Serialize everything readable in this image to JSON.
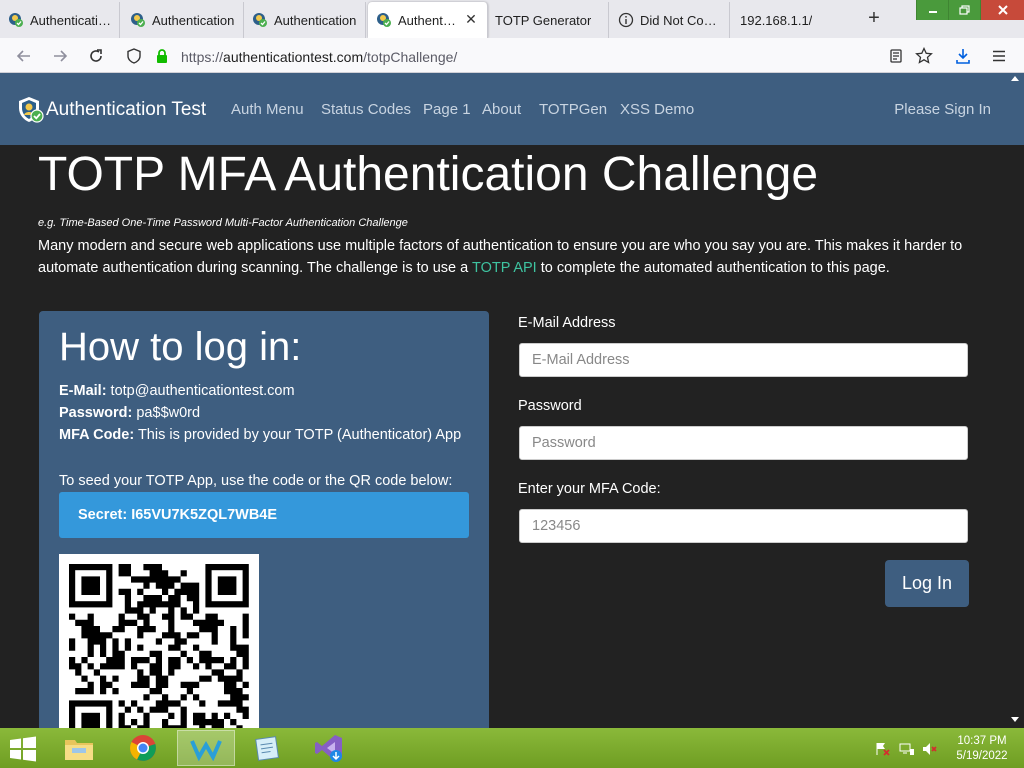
{
  "browser": {
    "tabs": [
      {
        "label": "Authentication",
        "favicon": "auth-shield-icon"
      },
      {
        "label": "Authentication",
        "favicon": "auth-shield-icon"
      },
      {
        "label": "Authentication",
        "favicon": "auth-shield-icon"
      },
      {
        "label": "Authenticati",
        "favicon": "auth-shield-icon",
        "active": true
      },
      {
        "label": "TOTP Generator",
        "favicon": ""
      },
      {
        "label": "Did Not Conne",
        "favicon": "info-icon"
      },
      {
        "label": "192.168.1.1/",
        "favicon": ""
      }
    ],
    "close_glyph": "✕",
    "new_tab_glyph": "+",
    "url": {
      "prefix": "https://",
      "host": "authenticationtest.com",
      "path": "/totpChallenge/"
    }
  },
  "site": {
    "brand": "Authentication Test",
    "menu": [
      "Auth Menu",
      "Status Codes",
      "Page 1",
      "About",
      "TOTPGen",
      "XSS Demo"
    ],
    "signin": "Please Sign In",
    "colors": {
      "navbar": "#3e5e80",
      "accent_link": "#3ec3a0",
      "secret_bg": "#3498db"
    }
  },
  "page": {
    "title": "TOTP MFA Authentication Challenge",
    "subtitle": "e.g. Time-Based One-Time Password Multi-Factor Authentication Challenge",
    "intro_before": "Many modern and secure web applications use multiple factors of authentication to ensure you are who you say you are. This makes it harder to automate authentication during scanning. The challenge is to use a ",
    "intro_link": "TOTP API",
    "intro_after": " to complete the automated authentication to this page."
  },
  "card": {
    "title": "How to log in:",
    "email_label": "E-Mail:",
    "email_value": " totp@authenticationtest.com",
    "password_label": "Password:",
    "password_value": " pa$$w0rd",
    "mfa_label": "MFA Code:",
    "mfa_value": " This is provided by your TOTP (Authenticator) App",
    "seed_text": "To seed your TOTP App, use the code or the QR code below:",
    "secret": "Secret: I65VU7K5ZQL7WB4E"
  },
  "form": {
    "email_label": "E-Mail Address",
    "email_placeholder": "E-Mail Address",
    "password_label": "Password",
    "password_placeholder": "Password",
    "mfa_label": "Enter your MFA Code:",
    "mfa_placeholder": "123456",
    "login_button": "Log In"
  },
  "taskbar": {
    "apps": [
      "file-explorer-icon",
      "chrome-icon",
      "wing-ide-icon",
      "notepad-icon",
      "visual-studio-icon"
    ],
    "time": "10:37 PM",
    "date": "5/19/2022"
  }
}
